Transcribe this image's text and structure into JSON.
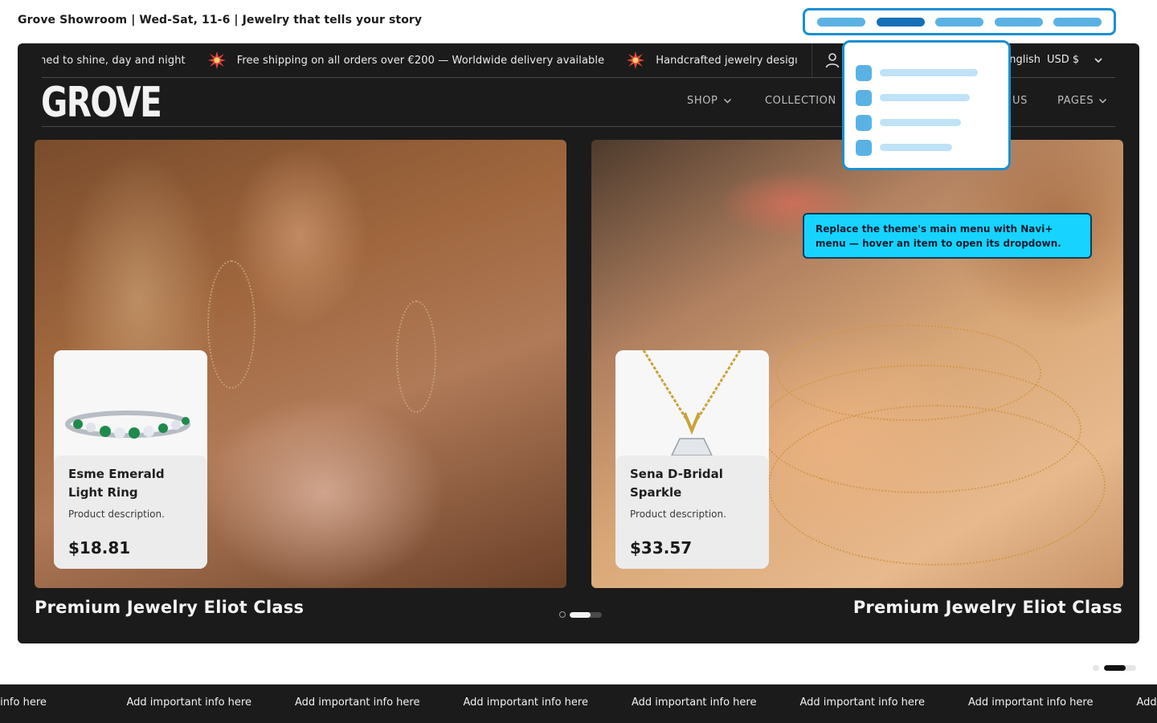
{
  "top_caption": "Grove Showroom | Wed-Sat, 11-6 | Jewelry that tells your story",
  "announcement": {
    "items": [
      "esigned to shine, day and night",
      "Free shipping on all orders over €200 — Worldwide delivery available",
      "Handcrafted jewelry desigı"
    ],
    "icon": "sparkle-burst-icon"
  },
  "header": {
    "language": "English",
    "currency": "USD $",
    "logo": "GROVE"
  },
  "nav": {
    "shop": "SHOP",
    "collections": "COLLECTION",
    "about": "US",
    "pages": "PAGES"
  },
  "slides": [
    {
      "title": "Premium Jewelry Eliot Class",
      "product": {
        "name": "Esme Emerald Light Ring",
        "description": "Product description.",
        "price": "$18.81"
      }
    },
    {
      "title": "Premium Jewelry Eliot Class",
      "product": {
        "name": "Sena D-Bridal Sparkle",
        "description": "Product description.",
        "price": "$33.57"
      }
    }
  ],
  "tooltip": {
    "text": "Replace the theme's main menu with Navi+ menu — hover an item to open its dropdown."
  },
  "bottom_bar": {
    "items": [
      "portant info here",
      "Add important info here",
      "Add important info here",
      "Add important info here",
      "Add important info here",
      "Add important info here",
      "Add important info here",
      "Add"
    ]
  },
  "colors": {
    "accent": "#1b8fd1",
    "tooltip_bg": "#16d4ff",
    "frame_bg": "#1b1b1b"
  }
}
